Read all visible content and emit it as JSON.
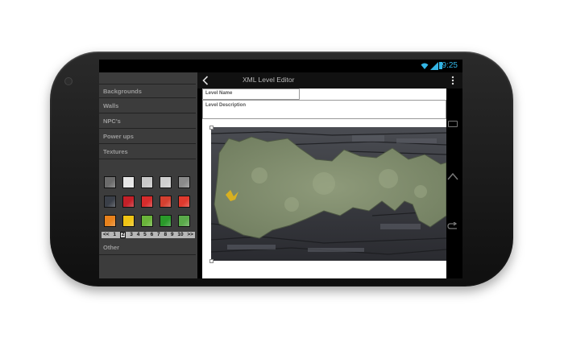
{
  "status_bar": {
    "time": "9:25"
  },
  "action_bar": {
    "title": "XML Level Editor"
  },
  "drawer": {
    "items": [
      "Backgrounds",
      "Walls",
      "NPC's",
      "Power ups",
      "Textures"
    ],
    "other_label": "Other",
    "pager": {
      "prev": "<<",
      "pages": [
        "1",
        "2",
        "3",
        "4",
        "5",
        "6",
        "7",
        "8",
        "9",
        "10"
      ],
      "current": "2",
      "next": ">>"
    },
    "swatch_colors": [
      [
        "#6b6b6b",
        "#e6e6e6",
        "#c8c8c8",
        "#cfcfcf",
        "#8a8a8a"
      ],
      [
        "#3a3f48",
        "#c42028",
        "#d62c2c",
        "#d44030",
        "#e03a2e"
      ],
      [
        "#e8821c",
        "#f0c414",
        "#6ab43a",
        "#2a9a2a",
        "#5aaa4a"
      ]
    ]
  },
  "form": {
    "level_name_label": "Level Name",
    "level_description_label": "Level Description"
  },
  "colors": {
    "accent": "#33b5e5",
    "drawer_bg": "#3c3c3c"
  }
}
